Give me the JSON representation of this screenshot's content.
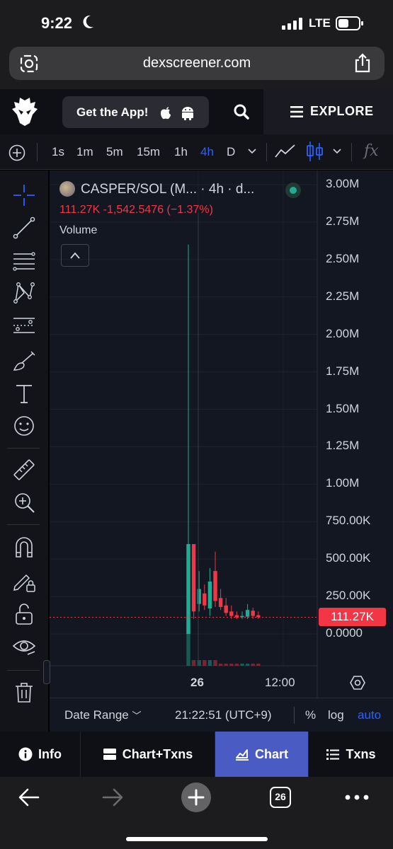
{
  "status_bar": {
    "time": "9:22",
    "network": "LTE"
  },
  "browser": {
    "url": "dexscreener.com",
    "tab_count": "26"
  },
  "nav": {
    "get_app_label": "Get the App!",
    "explore_label": "EXPLORE"
  },
  "toolbar": {
    "intervals": [
      "1s",
      "1m",
      "5m",
      "15m",
      "1h",
      "4h",
      "D"
    ],
    "active_interval": "4h",
    "fx_label": "fx"
  },
  "chart_header": {
    "pair_label": "CASPER/SOL (M...",
    "interval_label": "· 4h · d...",
    "ohlc_line": "111.27K  -1,542.5476 (−1.37%)",
    "volume_label": "Volume"
  },
  "chart_data": {
    "type": "bar",
    "title": "",
    "ylabel": "Volume",
    "y_ticks": [
      "3.00M",
      "2.75M",
      "2.50M",
      "2.25M",
      "2.00M",
      "1.75M",
      "1.50M",
      "1.25M",
      "1.00M",
      "750.00K",
      "500.00K",
      "250.00K",
      "0.0000"
    ],
    "ylim": [
      0,
      3000000
    ],
    "x_ticks": [
      "26",
      "12:00"
    ],
    "current_value_label": "111.27K",
    "current_value": 111270,
    "candles": [
      {
        "open": 0,
        "close": 600000,
        "high": 2600000,
        "low": 0,
        "dir": "up"
      },
      {
        "open": 600000,
        "close": 150000,
        "high": 600000,
        "low": 100000,
        "dir": "down"
      },
      {
        "open": 200000,
        "close": 300000,
        "high": 420000,
        "low": 150000,
        "dir": "up"
      },
      {
        "open": 270000,
        "close": 190000,
        "high": 330000,
        "low": 160000,
        "dir": "down"
      },
      {
        "open": 170000,
        "close": 350000,
        "high": 440000,
        "low": 120000,
        "dir": "up"
      },
      {
        "open": 420000,
        "close": 220000,
        "high": 550000,
        "low": 180000,
        "dir": "down"
      },
      {
        "open": 240000,
        "close": 180000,
        "high": 300000,
        "low": 160000,
        "dir": "down"
      },
      {
        "open": 190000,
        "close": 140000,
        "high": 240000,
        "low": 120000,
        "dir": "down"
      },
      {
        "open": 150000,
        "close": 120000,
        "high": 190000,
        "low": 100000,
        "dir": "down"
      },
      {
        "open": 125000,
        "close": 110000,
        "high": 150000,
        "low": 100000,
        "dir": "down"
      },
      {
        "open": 112000,
        "close": 120000,
        "high": 150000,
        "low": 100000,
        "dir": "up"
      },
      {
        "open": 115000,
        "close": 160000,
        "high": 200000,
        "low": 100000,
        "dir": "up"
      },
      {
        "open": 155000,
        "close": 120000,
        "high": 175000,
        "low": 100000,
        "dir": "down"
      },
      {
        "open": 125000,
        "close": 111270,
        "high": 150000,
        "low": 100000,
        "dir": "down"
      }
    ],
    "colors": {
      "up": "#22ab94",
      "down": "#f23645",
      "background": "#131722",
      "grid": "#1e222d"
    }
  },
  "chart_footer": {
    "date_range_label": "Date Range",
    "timezone_label": "21:22:51 (UTC+9)",
    "percent_label": "%",
    "log_label": "log",
    "auto_label": "auto"
  },
  "tabs": [
    {
      "label": "Info",
      "icon": "info-icon",
      "active": false
    },
    {
      "label": "Chart+Txns",
      "icon": "chart-txns-icon",
      "active": false
    },
    {
      "label": "Chart",
      "icon": "chart-icon",
      "active": true
    },
    {
      "label": "Txns",
      "icon": "list-icon",
      "active": false
    }
  ],
  "left_tools": [
    "crosshair-icon",
    "trend-line-icon",
    "fib-icon",
    "pattern-icon",
    "prediction-icon",
    "brush-icon",
    "text-icon",
    "emoji-icon",
    "ruler-icon",
    "zoom-in-icon",
    "magnet-icon",
    "lock-drawing-icon",
    "lock-icon",
    "eye-icon",
    "trash-icon"
  ]
}
